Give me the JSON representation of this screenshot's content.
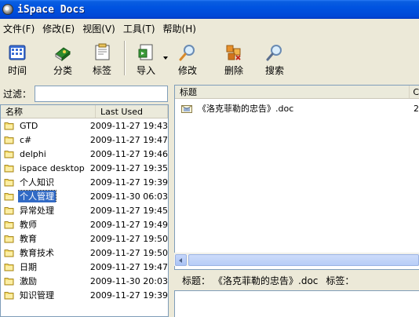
{
  "window": {
    "title": "iSpace Docs"
  },
  "menu": [
    {
      "label": "文件(F)"
    },
    {
      "label": "修改(E)"
    },
    {
      "label": "视图(V)"
    },
    {
      "label": "工具(T)"
    },
    {
      "label": "帮助(H)"
    }
  ],
  "toolbar": {
    "time": "时间",
    "category": "分类",
    "tag": "标签",
    "import": "导入",
    "edit": "修改",
    "delete": "删除",
    "search": "搜索"
  },
  "filter": {
    "label": "过滤：",
    "value": ""
  },
  "category_list": {
    "headers": {
      "name": "名称",
      "last_used": "Last Used"
    },
    "rows": [
      {
        "name": "GTD",
        "last_used": "2009-11-27 19:43"
      },
      {
        "name": "c#",
        "last_used": "2009-11-27 19:47"
      },
      {
        "name": "delphi",
        "last_used": "2009-11-27 19:46"
      },
      {
        "name": "ispace desktop",
        "last_used": "2009-11-27 19:35"
      },
      {
        "name": "个人知识",
        "last_used": "2009-11-27 19:39"
      },
      {
        "name": "个人管理",
        "last_used": "2009-11-30 06:03",
        "selected": true
      },
      {
        "name": "异常处理",
        "last_used": "2009-11-27 19:45"
      },
      {
        "name": "教师",
        "last_used": "2009-11-27 19:49"
      },
      {
        "name": "教育",
        "last_used": "2009-11-27 19:50"
      },
      {
        "name": "教育技术",
        "last_used": "2009-11-27 19:50"
      },
      {
        "name": "日期",
        "last_used": "2009-11-27 19:47"
      },
      {
        "name": "激励",
        "last_used": "2009-11-30 20:03"
      },
      {
        "name": "知识管理",
        "last_used": "2009-11-27 19:39"
      }
    ]
  },
  "documents": {
    "headers": {
      "title": "标题",
      "extra": "C"
    },
    "rows": [
      {
        "title": "《洛克菲勒的忠告》.doc",
        "extra": "2"
      }
    ]
  },
  "details": {
    "title_label": "标题：",
    "title_value": "《洛克菲勒的忠告》.doc",
    "tag_label": "标签："
  },
  "colors": {
    "titlebar": "#0053e0",
    "selection": "#316ac5",
    "window_bg": "#ece9d8",
    "border": "#7f9db9"
  },
  "icons": {
    "time": "calendar-grid-icon",
    "category": "green-book-icon",
    "tag": "tag-note-icon",
    "import": "import-document-icon",
    "edit": "magnifier-edit-icon",
    "delete": "delete-blocks-icon",
    "search": "magnifier-search-icon"
  }
}
